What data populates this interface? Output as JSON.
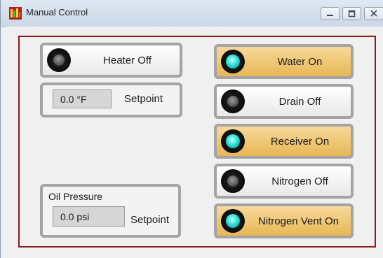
{
  "window": {
    "title": "Manual Control"
  },
  "controls": {
    "heater": {
      "label": "Heater Off",
      "state": "off"
    },
    "water": {
      "label": "Water On",
      "state": "on"
    },
    "drain": {
      "label": "Drain Off",
      "state": "off"
    },
    "receiver": {
      "label": "Receiver On",
      "state": "on"
    },
    "nitrogen": {
      "label": "Nitrogen Off",
      "state": "off"
    },
    "nitrogen_vent": {
      "label": "Nitrogen Vent On",
      "state": "on"
    }
  },
  "heater_setpoint": {
    "value": "0.0 °F",
    "label": "Setpoint"
  },
  "oil_pressure": {
    "title": "Oil Pressure",
    "value": "0.0 psi",
    "label": "Setpoint"
  },
  "colors": {
    "panel_border": "#8b1a1a",
    "button_on": "#e7b754",
    "button_off": "#f0f0f0",
    "led_on": "#2fe2d9",
    "led_off": "#5e5e5e"
  },
  "icons": [
    "app-icon",
    "minimize-icon",
    "maximize-icon",
    "close-icon",
    "indicator-led"
  ]
}
